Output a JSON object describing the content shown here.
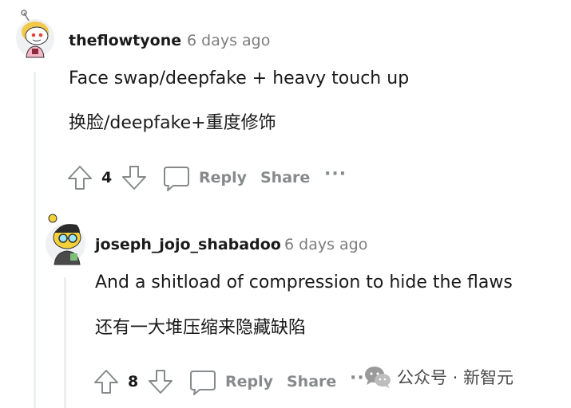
{
  "comments": [
    {
      "username": "theflowtyone",
      "separator": "·",
      "timestamp": "6 days ago",
      "text_en": "Face swap/deepfake + heavy touch up",
      "text_zh": "换脸/deepfake+重度修饰",
      "vote_count": "4",
      "reply_label": "Reply",
      "share_label": "Share",
      "more_label": "···"
    },
    {
      "username": "joseph_jojo_shabadoo",
      "separator": "·",
      "timestamp": "6 days ago",
      "text_en": "And a shitload of compression to hide the flaws",
      "text_zh": "还有一大堆压缩来隐藏缺陷",
      "vote_count": "8",
      "reply_label": "Reply",
      "share_label": "Share",
      "more_label": "···"
    }
  ],
  "watermark": {
    "text": "公众号 · 新智元",
    "icon": "wechat-icon"
  },
  "colors": {
    "meta_gray": "#7c7c7c",
    "action_gray": "#878a8c",
    "thread_line": "#edeff1"
  }
}
